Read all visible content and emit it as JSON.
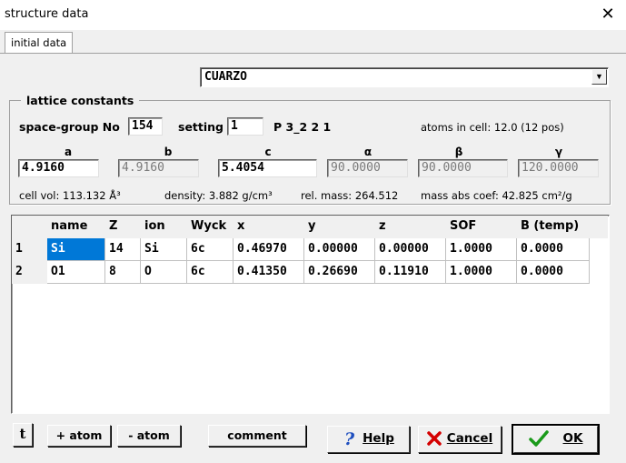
{
  "window": {
    "title": "structure data",
    "close_glyph": "✕"
  },
  "tab": {
    "label": "initial data"
  },
  "combo": {
    "value": "CUARZO",
    "arrow_icon": "chevron-down-icon"
  },
  "lattice": {
    "legend": "lattice constants",
    "spacegroup_label": "space-group No",
    "spacegroup_value": "154",
    "setting_label": "setting",
    "setting_value": "1",
    "symbol": "P 3_2 2 1",
    "atoms_in_cell": "atoms in cell: 12.0   (12 pos)",
    "headers": {
      "a": "a",
      "b": "b",
      "c": "c",
      "alpha": "α",
      "beta": "β",
      "gamma": "γ"
    },
    "values": {
      "a": "4.9160",
      "b": "4.9160",
      "c": "5.4054",
      "alpha": "90.0000",
      "beta": "90.0000",
      "gamma": "120.0000"
    },
    "cell_vol": "cell vol: 113.132 Å³",
    "density": "density: 3.882 g/cm³",
    "rel_mass": "rel. mass: 264.512",
    "mass_abs": "mass abs coef: 42.825 cm²/g"
  },
  "table": {
    "columns": [
      "name",
      "Z",
      "ion",
      "Wyck",
      "x",
      "y",
      "z",
      "SOF",
      "B (temp)"
    ],
    "rows": [
      {
        "num": "1",
        "cells": [
          "Si",
          "14",
          "Si",
          "6c",
          "0.46970",
          "0.00000",
          "0.00000",
          "1.0000",
          "0.0000"
        ]
      },
      {
        "num": "2",
        "cells": [
          "O1",
          "8",
          "O",
          "6c",
          "0.41350",
          "0.26690",
          "0.11910",
          "1.0000",
          "0.0000"
        ]
      }
    ]
  },
  "buttons": {
    "tool": "t",
    "add_atom": "+ atom",
    "remove_atom": "- atom",
    "comment": "comment",
    "help": "Help",
    "cancel": "Cancel",
    "ok": "OK"
  },
  "colors": {
    "selection": "#0078d7",
    "help_icon": "#1f4fbf",
    "cancel_icon": "#d40000",
    "ok_icon": "#1a9a1a"
  }
}
